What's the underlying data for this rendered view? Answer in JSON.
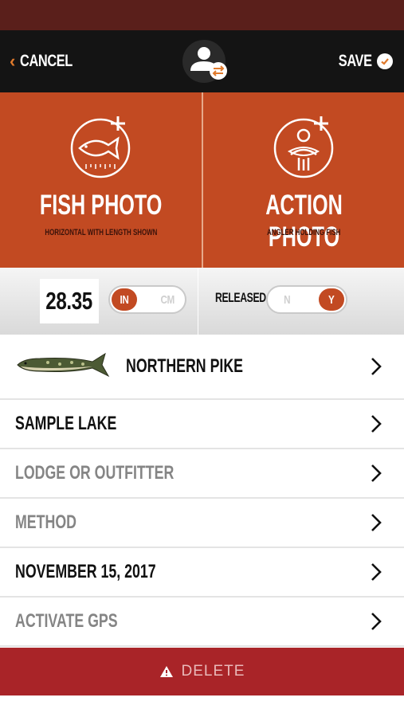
{
  "nav": {
    "cancel_label": "CANCEL",
    "save_label": "SAVE"
  },
  "photos": {
    "fish": {
      "title": "FISH PHOTO",
      "subtitle": "HORIZONTAL WITH LENGTH SHOWN"
    },
    "action": {
      "title": "ACTION PHOTO",
      "subtitle": "ANGLER HOLDING FISH"
    }
  },
  "measure": {
    "length_value": "28.35",
    "units": [
      {
        "label": "IN",
        "selected": true
      },
      {
        "label": "CM",
        "selected": false
      }
    ],
    "released_label": "RELEASED",
    "released_options": [
      {
        "label": "N",
        "selected": false
      },
      {
        "label": "Y",
        "selected": true
      }
    ]
  },
  "rows": [
    {
      "label": "NORTHERN PIKE",
      "state": "set"
    },
    {
      "label": "SAMPLE LAKE",
      "state": "set"
    },
    {
      "label": "LODGE OR OUTFITTER",
      "state": "placeholder"
    },
    {
      "label": "METHOD",
      "state": "placeholder"
    },
    {
      "label": "NOVEMBER 15, 2017",
      "state": "set"
    },
    {
      "label": "ACTIVATE GPS",
      "state": "placeholder"
    }
  ],
  "delete_label": "DELETE",
  "colors": {
    "accent": "#c24a22",
    "nav_bg": "#141414",
    "status_bg": "#5a1f1b",
    "delete_bg": "#a92428",
    "chevron_orange": "#e07a2c"
  },
  "icons": {
    "back": "chevron-left-icon",
    "save": "checkmark-circle-icon",
    "profile": "user-swap-icon",
    "fish_photo": "fish-add-icon",
    "action_photo": "angler-add-icon",
    "row_arrow": "chevron-right-icon",
    "delete": "warning-triangle-icon"
  }
}
